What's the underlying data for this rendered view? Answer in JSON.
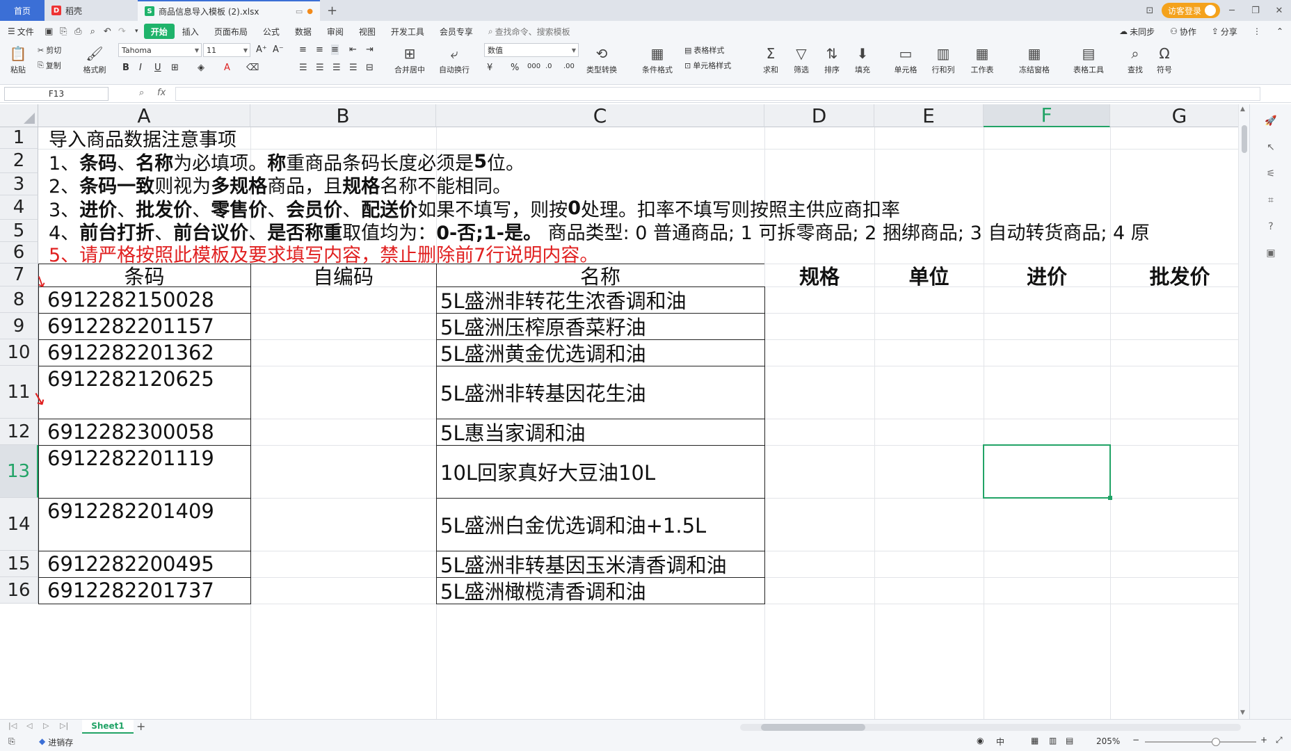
{
  "tabs": {
    "home": "首页",
    "daoke": "稻壳",
    "file": "商品信息导入模板 (2).xlsx",
    "guest_login": "访客登录"
  },
  "menu": {
    "file": "文件",
    "items": [
      "开始",
      "插入",
      "页面布局",
      "公式",
      "数据",
      "审阅",
      "视图",
      "开发工具",
      "会员专享"
    ],
    "search_placeholder": "查找命令、搜索模板",
    "unsync": "未同步",
    "collab": "协作",
    "share": "分享"
  },
  "ribbon": {
    "paste": "粘贴",
    "cut": "剪切",
    "copy": "复制",
    "format_painter": "格式刷",
    "font_name": "Tahoma",
    "font_size": "11",
    "merge_center": "合并居中",
    "wrap": "自动换行",
    "number_format": "数值",
    "type_convert": "类型转换",
    "cond_format": "条件格式",
    "table_style": "表格样式",
    "cell_style": "单元格样式",
    "sum": "求和",
    "filter": "筛选",
    "sort": "排序",
    "fill": "填充",
    "cell": "单元格",
    "row_col": "行和列",
    "worksheet": "工作表",
    "freeze": "冻结窗格",
    "table_tools": "表格工具",
    "find": "查找",
    "symbol": "符号"
  },
  "formula_bar": {
    "name_box": "F13",
    "fx": "fx",
    "content": ""
  },
  "columns": [
    "A",
    "B",
    "C",
    "D",
    "E",
    "F",
    "G"
  ],
  "rows": [
    "1",
    "2",
    "3",
    "4",
    "5",
    "6",
    "7",
    "8",
    "9",
    "10",
    "11",
    "12",
    "13",
    "14",
    "15",
    "16"
  ],
  "notes": {
    "r1": "导入商品数据注意事项",
    "r2": [
      "1、",
      "条码",
      "、",
      "名称",
      "为必填项。",
      "称",
      "重商品条码长度必须是",
      "5",
      "位。"
    ],
    "r3": [
      "2、",
      "条码一致",
      "则视为",
      "多规格",
      "商品，且",
      "规格",
      "名称不能相同。"
    ],
    "r4": [
      "3、",
      "进价",
      "、",
      "批发价",
      "、",
      "零售价",
      "、",
      "会员价",
      "、",
      "配送价",
      "如果不填写，则按",
      "0",
      "处理。扣率不填写则按照主供应商扣率"
    ],
    "r5": [
      "4、",
      "前台打折",
      "、",
      "前台议价",
      "、",
      "是否称重",
      "取值均为：",
      "0-否;1-是。",
      " 商品类型: 0 普通商品; 1 可拆零商品; 2 捆绑商品; 3 自动转货商品; 4 原"
    ],
    "r6": "5、请严格按照此模板及要求填写内容，禁止删除前7行说明内容。"
  },
  "headers": [
    "条码",
    "自编码",
    "名称",
    "规格",
    "单位",
    "进价",
    "批发价"
  ],
  "products": [
    {
      "barcode": "6912282150028",
      "name": "5L盛洲非转花生浓香调和油"
    },
    {
      "barcode": "6912282201157",
      "name": "5L盛洲压榨原香菜籽油"
    },
    {
      "barcode": "6912282201362",
      "name": "5L盛洲黄金优选调和油"
    },
    {
      "barcode": "6912282120625",
      "name": "5L盛洲非转基因花生油"
    },
    {
      "barcode": "6912282300058",
      "name": "5L惠当家调和油"
    },
    {
      "barcode": "6912282201119",
      "name": "10L回家真好大豆油10L"
    },
    {
      "barcode": "6912282201409",
      "name": "5L盛洲白金优选调和油+1.5L"
    },
    {
      "barcode": "6912282200495",
      "name": "5L盛洲非转基因玉米清香调和油"
    },
    {
      "barcode": "6912282201737",
      "name": "5L盛洲橄榄清香调和油"
    }
  ],
  "sheet_tab": "Sheet1",
  "status": {
    "inventory": "进销存",
    "zoom": "205%"
  },
  "colors": {
    "accent_green": "#1fb36b",
    "tab_blue": "#3b6fd6",
    "guest_orange": "#f4a21c",
    "note_red": "#e02020"
  }
}
